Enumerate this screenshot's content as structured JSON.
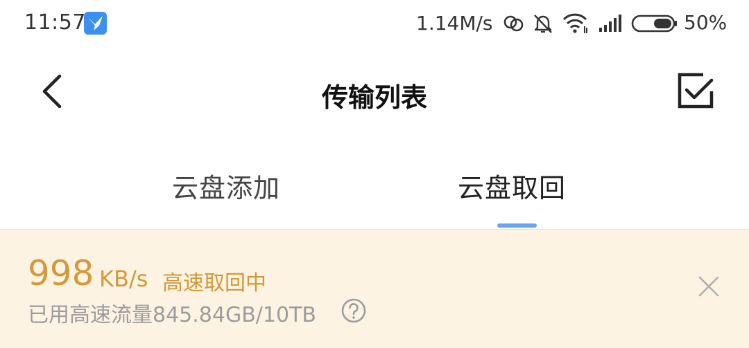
{
  "status_bar": {
    "time": "11:57",
    "network_speed": "1.14M/s",
    "battery_percent": "50%",
    "icons": [
      "app-bird-icon",
      "sync-icon",
      "mute-bell-icon",
      "wifi-icon",
      "signal-icon",
      "battery-icon"
    ]
  },
  "header": {
    "title": "传输列表",
    "back_icon": "chevron-left-icon",
    "select_icon": "checkbox-select-icon"
  },
  "tabs": [
    {
      "label": "云盘添加",
      "active": false
    },
    {
      "label": "云盘取回",
      "active": true
    }
  ],
  "banner": {
    "speed_value": "998",
    "speed_unit": "KB/s",
    "status": "高速取回中",
    "usage": "已用高速流量845.84GB/10TB",
    "help_icon": "question-circle-icon",
    "close_icon": "close-icon"
  },
  "colors": {
    "accent_blue": "#6aa4f2",
    "banner_bg": "#fdf3e3",
    "speed_gold": "#d29a38",
    "muted_gray": "#9c9c9c"
  }
}
